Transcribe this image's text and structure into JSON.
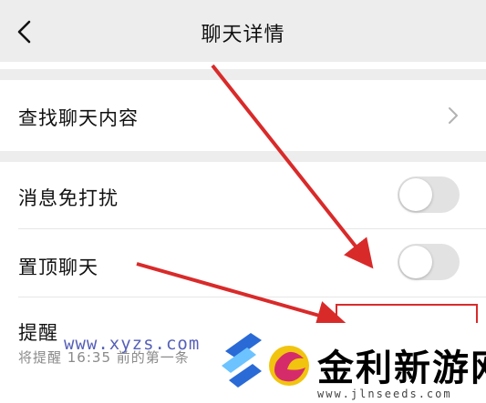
{
  "nav": {
    "title": "聊天详情",
    "back_icon": "chevron-left-icon"
  },
  "rows": {
    "search": {
      "label": "查找聊天内容",
      "chevron": "chevron-right-icon"
    },
    "mute": {
      "label": "消息免打扰",
      "enabled": false
    },
    "pin": {
      "label": "置顶聊天",
      "enabled": false
    },
    "remind": {
      "label": "提醒",
      "subtitle": "将提醒 16:35 前的第一条",
      "enabled": true
    }
  },
  "watermark": {
    "url": "www.xyzs.com",
    "brand": "金利新游网",
    "site": "www.jlnseeds.com"
  },
  "colors": {
    "accent": "#07c160",
    "annotation": "#d92a2a",
    "background": "#ededed"
  }
}
